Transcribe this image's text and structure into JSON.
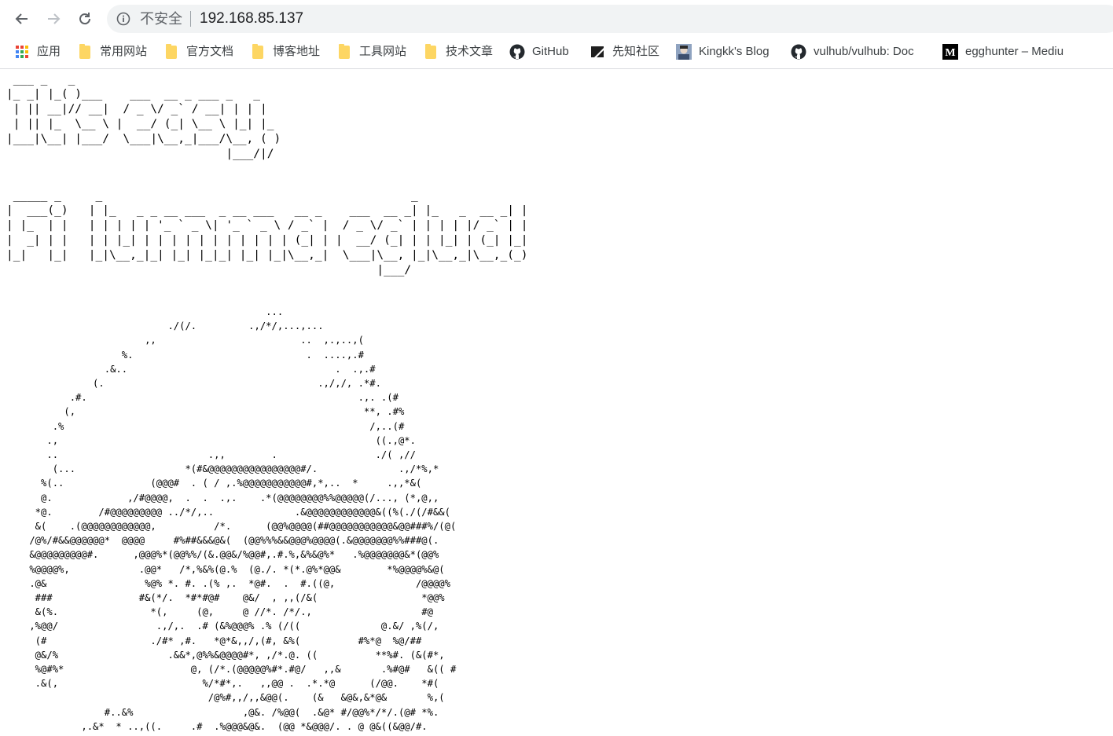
{
  "browser": {
    "security_label": "不安全",
    "url": "192.168.85.137"
  },
  "bookmarks": [
    {
      "label": "应用",
      "icon": "apps-grid-icon"
    },
    {
      "label": "常用网站",
      "icon": "folder-icon"
    },
    {
      "label": "官方文档",
      "icon": "folder-icon"
    },
    {
      "label": "博客地址",
      "icon": "folder-icon"
    },
    {
      "label": "工具网站",
      "icon": "folder-icon"
    },
    {
      "label": "技术文章",
      "icon": "folder-icon"
    },
    {
      "label": "GitHub",
      "icon": "github-icon"
    },
    {
      "label": "先知社区",
      "icon": "xianzhi-icon"
    },
    {
      "label": "Kingkk's Blog",
      "icon": "avatar-icon"
    },
    {
      "label": "vulhub/vulhub: Doc",
      "icon": "github-icon"
    },
    {
      "label": "egghunter – Mediu",
      "icon": "medium-icon"
    }
  ],
  "colors": {
    "accent": "#1a73e8",
    "folder": "#fdd663",
    "omnibox_bg": "#f1f3f4",
    "text": "#000000"
  },
  "page": {
    "banner_line1": " ___ _   _ \n|_ _| |_( )___    ___  __ _ ___ _   _ \n | || __|// __|  / _ \\/ _` / __| | | |\n | || |_  \\__ \\ |  __/ (_| \\__ \\ |_| |_ \n|___|\\__| |___/  \\___|\\__,_|___/\\__, ( )\n                                |___/|/ \n",
    "banner_line2": " _____ _     _                                             _ \n|  ___(_)   | |_   _ _ __ ___  _ __ ___   __ _    ___  __ _| |_   _  __ _| |\n| |_  | |   | | | | | '_ ` _ \\| '_ ` _ \\ / _` |  / _ \\/ _` | | | | |/ _` | |\n|  _| | |   | | |_| | | | | | | | | | | | (_| | |  __/ (_| | | |_| | (_| |_|\n|_|   |_|   |_|\\__,_|_| |_| |_|_| |_| |_|\\__,_|  \\___|\\__, |_|\\__,_|\\__,_(_)\n                                                      |___/ \n",
    "art": "                                             ...\n                            ./(/.         .,/*/,...,...\n                        ,,                         ..  ,.,..,(\n                    %.                              .  ....,.#\n                 .&..                                    .  .,.#\n               (.                                     .,/,/, .*#.\n           .#.                                               .,. .(#\n          (,                                                  **, .#%\n        .%                                                     /,..(#\n       .,                                                       ((.,@*.\n       ..                          .,,        .                 ./( ,//\n        (...                   *(#&@@@@@@@@@@@@@@@@#/.              .,/*%,*\n      %(..               (@@@#  . ( / ,.%@@@@@@@@@@@#,*,..  *     .,,*&(\n      @.             ,/#@@@@,  .  .  .,.    .*(@@@@@@@@%%@@@@@(/..., (*,@,,\n     *@.        /#@@@@@@@@@ ../*/,..              .&@@@@@@@@@@@@&((%(./(/#&&(\n     &(    .(@@@@@@@@@@@@,          /*.      (@@%@@@@(##@@@@@@@@@@@&@@###%/(@(\n    /@%/#&&@@@@@@*  @@@@     #%##&&&@&(  (@@%%%&&@@@%@@@@(.&@@@@@@@%%###@(.\n    &@@@@@@@@@#.      ,@@@%*(@@%%/(&.@@&/%@@#,.#.%,&%&@%*   .%@@@@@@@&*(@@%\n    %@@@@%,            .@@*   /*,%&%(@.%  (@./. *(*.@%*@@&        *%@@@@%&@(\n    .@&                 %@% *. #. .(% ,.  *@#.  .  #.((@,              /@@@@%\n     ###               #&(*/.  *#*#@#    @&/  , ,,(/&(                  *@@%\n     &(%.                *(,     (@,     @ //*. /*/.,                   #@\n    ,%@@/                 .,/,.  .# (&%@@@% .% (/((              @.&/ ,%(/,\n     (#                  ./#* ,#.   *@*&,,/,(#, &%(          #%*@  %@/##\n     @&/%                   .&&*,@%%&@@@@#*, ,/*.@. ((          **%#. (&(#*,\n     %@#%*                      @, (/*.(@@@@@%#*.#@/   ,,&       .%#@#   &(( #\n     .&(,                         %/*#*,.   ,,@@ .  .*.*@      (/@@.    *#(\n                                   /@%#,,/,,&@@(.    (&   &@&,&*@&       %,(\n                 #..&%                   ,@&. /%@@(  .&@* #/@@%*/*/.(@# *%.\n             ,.&*  * ..,((.     .#  .%@@@&@&.  (@@ *&@@@/. . @ @&((&@@/#.\n           &    *&/@*&      /     &(    %  %%# #    &&.%@@&@*       % @& / ( *%@&%"
  }
}
